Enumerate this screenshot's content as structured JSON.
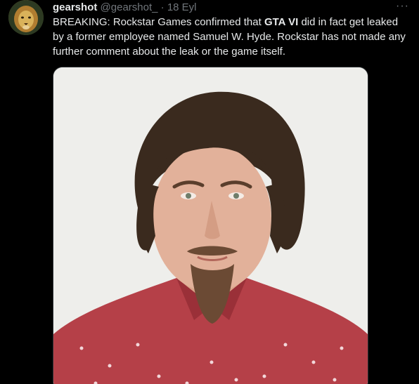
{
  "tweet": {
    "display_name": "gearshot",
    "handle": "@gearshot_",
    "separator": "·",
    "date": "18 Eyl",
    "more_glyph": "···",
    "text_prefix": "BREAKING: Rockstar Games confirmed that ",
    "text_bold": "GTA VI",
    "text_suffix": " did in fact get leaked by a former employee named Samuel W. Hyde. Rockstar has not made any further comment about the leak or the game itself."
  },
  "colors": {
    "background": "#000000",
    "primary_text": "#e7e9ea",
    "secondary_text": "#71767b",
    "shirt": "#b54048",
    "photo_background": "#eeeeeb"
  },
  "icons": {
    "more": "more-horizontal-icon",
    "avatar": "lion-avatar"
  }
}
